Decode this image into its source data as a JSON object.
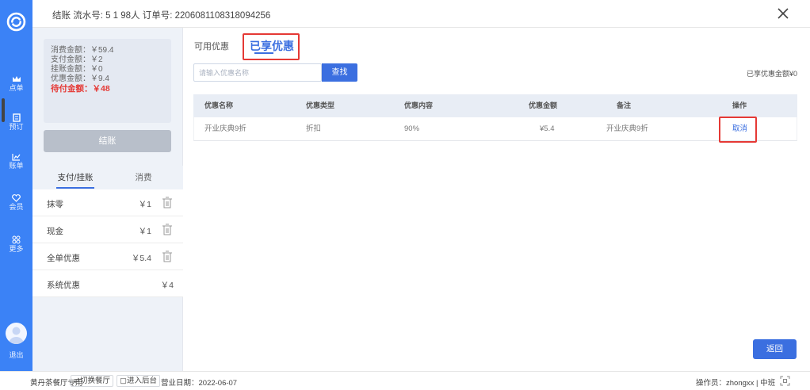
{
  "header": {
    "text": "结账  流水号: 5 1  98人  订单号: 2206081108318094256"
  },
  "nav": {
    "items": [
      {
        "label": "点单",
        "icon": "crown-icon"
      },
      {
        "label": "预订",
        "icon": "document-icon"
      },
      {
        "label": "账单",
        "icon": "chart-icon"
      },
      {
        "label": "会员",
        "icon": "heart-icon"
      },
      {
        "label": "更多",
        "icon": "grid-icon"
      }
    ],
    "logout_label": "退出"
  },
  "summary": {
    "consume": "消费金额：￥59.4",
    "paid": "支付金额：￥2",
    "credit": "挂账金额：￥0",
    "discount": "优惠金额：￥9.4",
    "pending": "待付金额：￥48"
  },
  "left_panel": {
    "checkout_label": "结账",
    "tabs": [
      "支付/挂账",
      "消费"
    ],
    "payments": [
      {
        "name": "抹零",
        "amount": "￥1"
      },
      {
        "name": "现金",
        "amount": "￥1"
      },
      {
        "name": "全单优惠",
        "amount": "￥5.4"
      },
      {
        "name": "系统优惠",
        "amount": "￥4"
      }
    ]
  },
  "main": {
    "tab_available": "可用优惠",
    "tab_enjoyed": "已享优惠",
    "search_placeholder": "请输入优惠名称",
    "search_button": "查找",
    "enjoyed_total": "已享优惠金额¥0",
    "table": {
      "headers": [
        "优惠名称",
        "优惠类型",
        "优惠内容",
        "优惠金额",
        "备注",
        "操作"
      ],
      "rows": [
        {
          "name": "开业庆典9折",
          "type": "折扣",
          "content": "90%",
          "amount": "¥5.4",
          "note": "开业庆典9折",
          "action": "取消"
        }
      ]
    },
    "back_button": "返回"
  },
  "footer": {
    "store": "黄丹茶餐厅专用",
    "switch_store": "切换餐厅",
    "enter_backend": "进入后台",
    "business_date": "营业日期：2022-06-07",
    "operator": "操作员：zhongxx | 中班"
  },
  "colors": {
    "nav_blue": "#3b82f6",
    "accent": "#3b6fe0",
    "highlight_red": "#e53935"
  }
}
